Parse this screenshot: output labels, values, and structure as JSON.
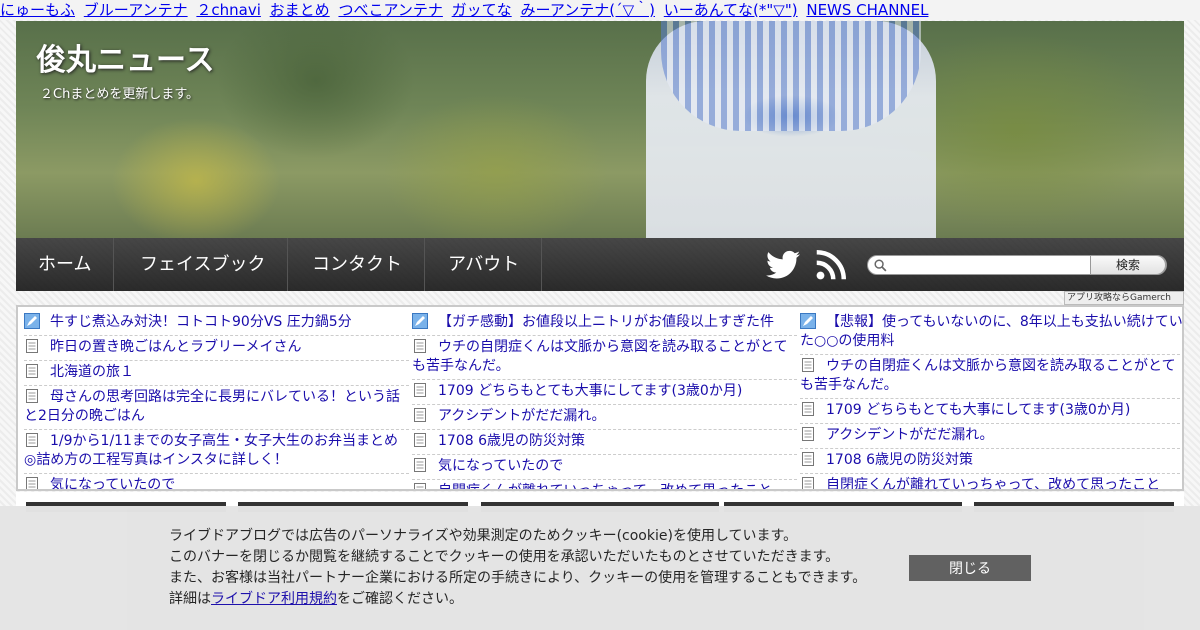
{
  "top_links": [
    "にゅーもふ",
    "ブルーアンテナ",
    "２chnavi",
    "おまとめ",
    "つべこアンテナ",
    "ガッてな",
    "みーアンテナ(´▽｀)",
    "いーあんてな(*\"▽\")",
    "NEWS CHANNEL"
  ],
  "header": {
    "title": "俊丸ニュース",
    "description": "２Chまとめを更新します。"
  },
  "nav": {
    "items": [
      "ホーム",
      "フェイスブック",
      "コンタクト",
      "アバウト"
    ],
    "social_icons": [
      "twitter-icon",
      "rss-icon"
    ],
    "search": {
      "placeholder": "",
      "button_label": "検索"
    }
  },
  "antenna_credit": "アプリ攻略ならGamerch",
  "antenna": {
    "columns": [
      [
        {
          "text": "牛すじ煮込み対決！コトコト90分VS 圧力鍋5分",
          "icon": "pen-icon"
        },
        {
          "text": "昨日の置き晩ごはんとラブリーメイさん",
          "icon": "page-icon"
        },
        {
          "text": "北海道の旅１",
          "icon": "page-icon"
        },
        {
          "text": "母さんの思考回路は完全に長男にバレている！という話と2日分の晩ごはん",
          "icon": "page-icon"
        },
        {
          "text": "1/9から1/11までの女子高生・女子大生のお弁当まとめ◎詰め方の工程写真はインスタに詳しく！",
          "icon": "page-icon"
        },
        {
          "text": "気になっていたので",
          "icon": "page-icon"
        }
      ],
      [
        {
          "text": "【ガチ感動】お値段以上ニトリがお値段以上すぎた件",
          "icon": "pen-icon"
        },
        {
          "text": "ウチの自閉症くんは文脈から意図を読み取ることがとても苦手なんだ。",
          "icon": "page-icon"
        },
        {
          "text": "1709 どちらもとても大事にしてます(3歳0か月)",
          "icon": "page-icon"
        },
        {
          "text": "アクシデントがだだ漏れ。",
          "icon": "page-icon"
        },
        {
          "text": "1708 6歳児の防災対策",
          "icon": "page-icon"
        },
        {
          "text": "気になっていたので",
          "icon": "page-icon"
        },
        {
          "text": "自閉症くんが離れていっちゃって、改めて思ったこと",
          "icon": "page-icon"
        }
      ],
      [
        {
          "text": "【悲報】使ってもいないのに、8年以上も支払い続けていた○○の使用料",
          "icon": "pen-icon"
        },
        {
          "text": "ウチの自閉症くんは文脈から意図を読み取ることがとても苦手なんだ。",
          "icon": "page-icon"
        },
        {
          "text": "1709 どちらもとても大事にしてます(3歳0か月)",
          "icon": "page-icon"
        },
        {
          "text": "アクシデントがだだ漏れ。",
          "icon": "page-icon"
        },
        {
          "text": "1708 6歳児の防災対策",
          "icon": "page-icon"
        },
        {
          "text": "自閉症くんが離れていっちゃって、改めて思ったこと",
          "icon": "page-icon"
        }
      ]
    ]
  },
  "cookie": {
    "line1": "ライブドアブログでは広告のパーソナライズや効果測定のためクッキー(cookie)を使用しています。",
    "line2": "このバナーを閉じるか閲覧を継続することでクッキーの使用を承認いただいたものとさせていただきます。",
    "line3": "また、お客様は当社パートナー企業における所定の手続きにより、クッキーの使用を管理することもできます。",
    "line4_prefix": "詳細は",
    "line4_link": "ライブドア利用規約",
    "line4_suffix": "をご確認ください。",
    "close_label": "閉じる"
  },
  "colors": {
    "link": "#1a0dab",
    "nav_bg": "#222222",
    "close_button": "#5f5f5f",
    "banner_bg": "#e4e4e4"
  }
}
